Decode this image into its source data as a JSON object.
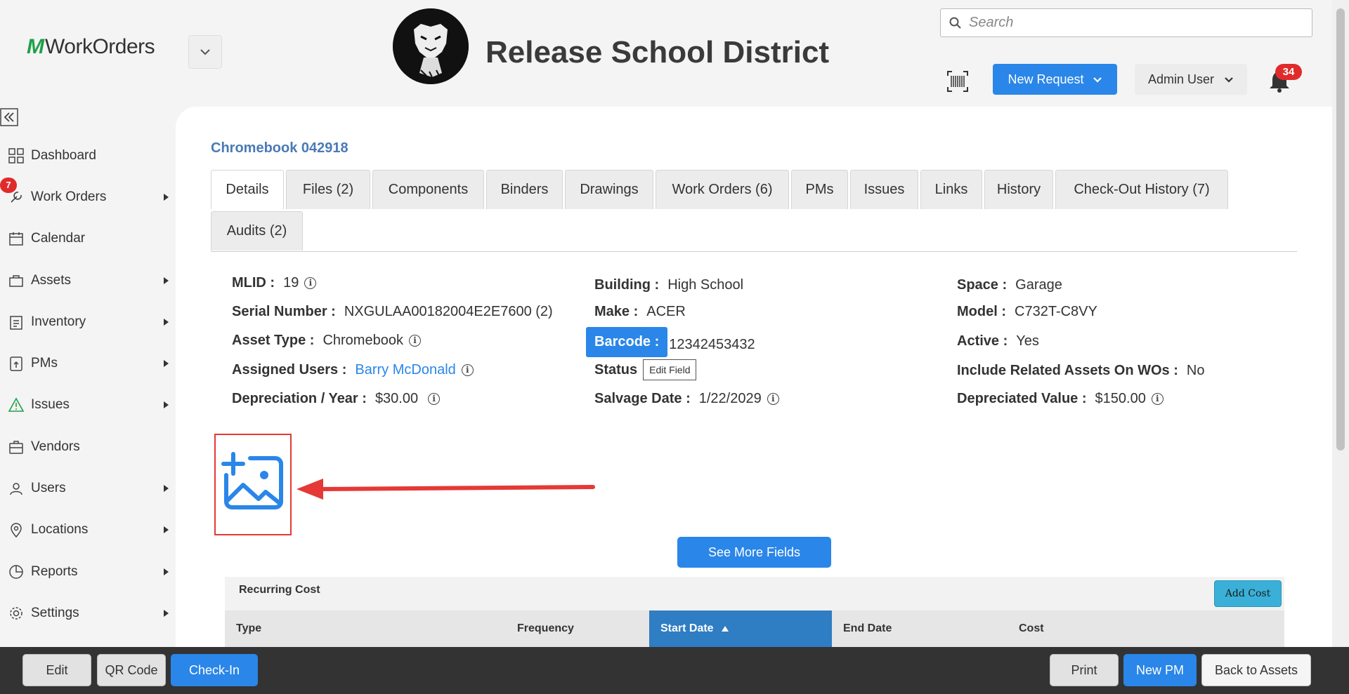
{
  "header": {
    "logo_mark": "M",
    "logo_text": "WorkOrders",
    "district_name": "Release School District",
    "search_placeholder": "Search",
    "new_request_label": "New Request",
    "user_label": "Admin User",
    "notification_count": "34"
  },
  "sidebar": {
    "items": [
      {
        "label": "Dashboard",
        "icon": "grid-icon"
      },
      {
        "label": "Work Orders",
        "icon": "wrench-icon",
        "badge": "7"
      },
      {
        "label": "Calendar",
        "icon": "calendar-icon"
      },
      {
        "label": "Assets",
        "icon": "asset-icon"
      },
      {
        "label": "Inventory",
        "icon": "clipboard-icon"
      },
      {
        "label": "PMs",
        "icon": "pm-icon"
      },
      {
        "label": "Issues",
        "icon": "warning-icon"
      },
      {
        "label": "Vendors",
        "icon": "briefcase-icon"
      },
      {
        "label": "Users",
        "icon": "users-icon"
      },
      {
        "label": "Locations",
        "icon": "location-icon"
      },
      {
        "label": "Reports",
        "icon": "pie-icon"
      },
      {
        "label": "Settings",
        "icon": "gear-icon"
      }
    ]
  },
  "asset": {
    "title": "Chromebook 042918",
    "tabs": [
      "Details",
      "Files (2)",
      "Components",
      "Binders",
      "Drawings",
      "Work Orders (6)",
      "PMs",
      "Issues",
      "Links",
      "History",
      "Check-Out History (7)",
      "Audits (2)"
    ],
    "fields": {
      "mlid_label": "MLID :",
      "mlid": "19",
      "serial_label": "Serial Number :",
      "serial": "NXGULAA00182004E2E7600 (2)",
      "type_label": "Asset Type :",
      "type": "Chromebook",
      "users_label": "Assigned Users :",
      "users": "Barry McDonald",
      "dep_label": "Depreciation / Year :",
      "dep": "$30.00",
      "building_label": "Building :",
      "building": "High School",
      "make_label": "Make :",
      "make": "ACER",
      "barcode_label": "Barcode :",
      "barcode": "12342453432",
      "status_label": "Status",
      "edit_tooltip": "Edit Field",
      "salvage_label": "Salvage Date :",
      "salvage": "1/22/2029",
      "space_label": "Space :",
      "space": "Garage",
      "model_label": "Model :",
      "model": "C732T-C8VY",
      "active_label": "Active :",
      "active": "Yes",
      "related_label": "Include Related Assets On WOs :",
      "related": "No",
      "depval_label": "Depreciated Value :",
      "depval": "$150.00"
    },
    "see_more_label": "See More Fields"
  },
  "recurring_cost": {
    "title": "Recurring Cost",
    "add_label": "Add Cost",
    "columns": [
      "Type",
      "Frequency",
      "Start Date",
      "End Date",
      "Cost"
    ],
    "sorted_column": "Start Date"
  },
  "footer": {
    "edit": "Edit",
    "qr": "QR Code",
    "checkin": "Check-In",
    "print": "Print",
    "new_pm": "New PM",
    "back": "Back to Assets"
  },
  "colors": {
    "accent": "#2a86e8",
    "brand_green": "#1ea04a",
    "badge_red": "#e02b2b"
  }
}
